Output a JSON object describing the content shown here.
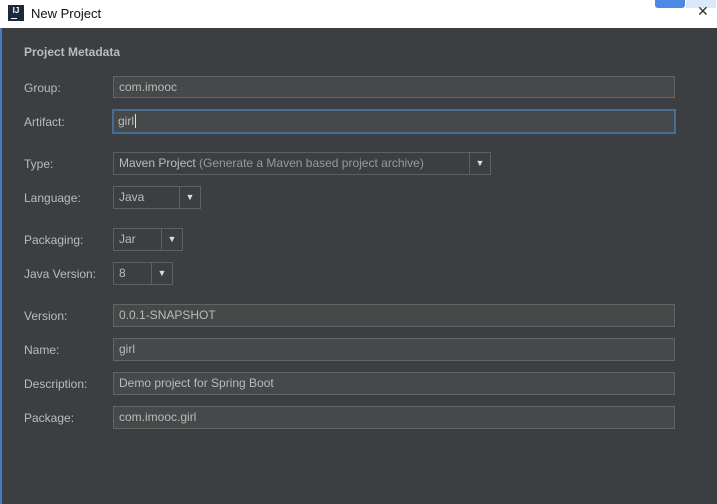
{
  "window": {
    "title": "New Project"
  },
  "section_title": "Project Metadata",
  "fields": {
    "group": {
      "label": "Group:",
      "value": "com.imooc"
    },
    "artifact": {
      "label": "Artifact:",
      "value": "girl"
    },
    "type": {
      "label": "Type:",
      "value": "Maven Project",
      "hint": "(Generate a Maven based project archive)"
    },
    "language": {
      "label": "Language:",
      "value": "Java"
    },
    "packaging": {
      "label": "Packaging:",
      "value": "Jar"
    },
    "java_version": {
      "label": "Java Version:",
      "value": "8"
    },
    "version": {
      "label": "Version:",
      "value": "0.0.1-SNAPSHOT"
    },
    "name": {
      "label": "Name:",
      "value": "girl"
    },
    "description": {
      "label": "Description:",
      "value": "Demo project for Spring Boot"
    },
    "package": {
      "label": "Package:",
      "value": "com.imooc.girl"
    }
  },
  "colors": {
    "background": "#3c3f41",
    "focus_border": "#466d94"
  }
}
